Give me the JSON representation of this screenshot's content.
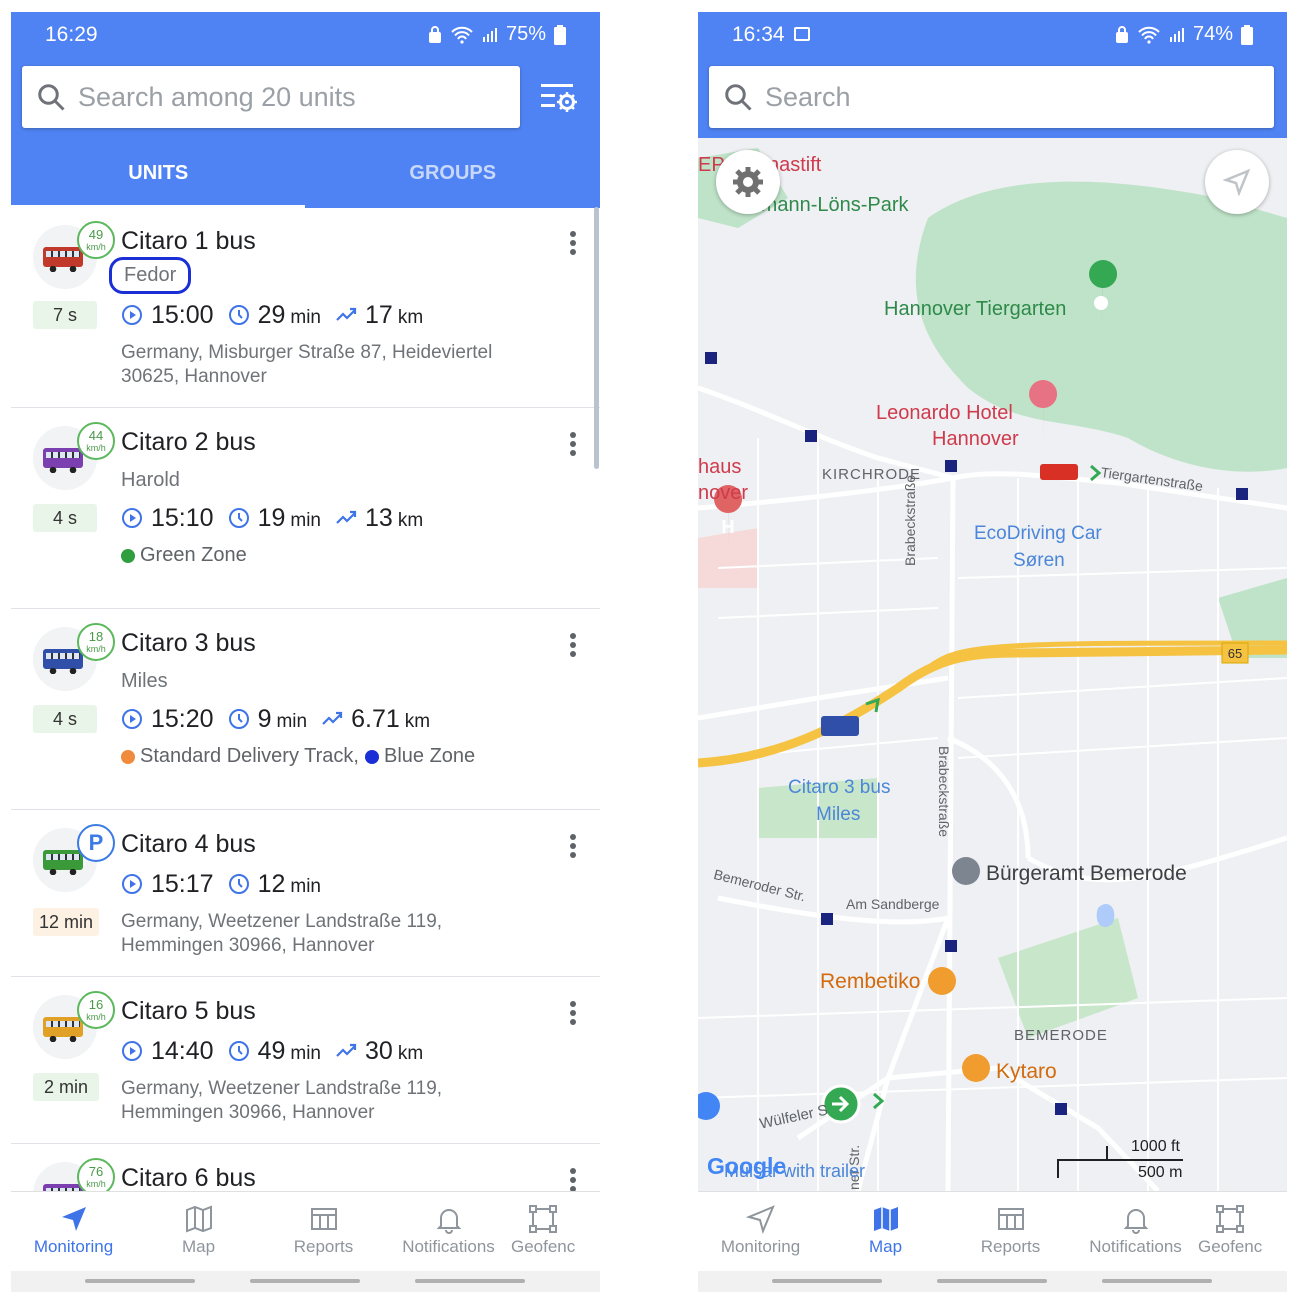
{
  "left": {
    "status": {
      "time": "16:29",
      "battery": "75%"
    },
    "search": {
      "placeholder": "Search among 20 units"
    },
    "tabs": [
      {
        "label": "UNITS"
      },
      {
        "label": "GROUPS"
      }
    ],
    "units": [
      {
        "name": "Citaro 1 bus",
        "driver": "Fedor",
        "speed": "49",
        "speed_unit": "km/h",
        "age": "7 s",
        "time": "15:00",
        "duration": "29",
        "duration_unit": "min",
        "distance": "17",
        "distance_unit": "km",
        "address_line1": "Germany, Misburger Straße 87, Heideviertel",
        "address_line2": "30625, Hannover",
        "bus_color": "#c0392b"
      },
      {
        "name": "Citaro 2 bus",
        "driver": "Harold",
        "speed": "44",
        "speed_unit": "km/h",
        "age": "4 s",
        "time": "15:10",
        "duration": "19",
        "duration_unit": "min",
        "distance": "13",
        "distance_unit": "km",
        "zone": "Green Zone",
        "zone_color": "#2e9e3e",
        "bus_color": "#7b3fb0"
      },
      {
        "name": "Citaro 3 bus",
        "driver": "Miles",
        "speed": "18",
        "speed_unit": "km/h",
        "age": "4 s",
        "time": "15:20",
        "duration": "9",
        "duration_unit": "min",
        "distance": "6.71",
        "distance_unit": "km",
        "zone_a": "Standard Delivery Track,",
        "zone_a_color": "#f08a3c",
        "zone_b": "Blue Zone",
        "zone_b_color": "#1a2fd6",
        "bus_color": "#2f4fa8"
      },
      {
        "name": "Citaro 4 bus",
        "parking": "P",
        "age": "12 min",
        "time": "15:17",
        "duration": "12",
        "duration_unit": "min",
        "address_line1": "Germany, Weetzener Landstraße 119,",
        "address_line2": "Hemmingen 30966, Hannover",
        "bus_color": "#3a9a3a"
      },
      {
        "name": "Citaro 5 bus",
        "speed": "16",
        "speed_unit": "km/h",
        "age": "2 min",
        "time": "14:40",
        "duration": "49",
        "duration_unit": "min",
        "distance": "30",
        "distance_unit": "km",
        "address_line1": "Germany, Weetzener Landstraße 119,",
        "address_line2": "Hemmingen 30966, Hannover",
        "bus_color": "#e0a126"
      },
      {
        "name": "Citaro 6 bus",
        "speed": "76",
        "speed_unit": "km/h",
        "bus_color": "#7b3fb0"
      }
    ],
    "nav": [
      {
        "label": "Monitoring"
      },
      {
        "label": "Map"
      },
      {
        "label": "Reports"
      },
      {
        "label": "Notifications"
      },
      {
        "label": "Geofenc"
      }
    ]
  },
  "right": {
    "status": {
      "time": "16:34",
      "battery": "74%"
    },
    "search": {
      "placeholder": "Search"
    },
    "map_labels": {
      "ep": "EP",
      "nastift": "nastift",
      "park": "rmann-Löns-Park",
      "tiergarten": "Hannover Tiergarten",
      "hotel_1": "Leonardo Hotel",
      "hotel_2": "Hannover",
      "haus": "haus",
      "nover": "nover",
      "kirchrode": "KIRCHRODE",
      "tiergartenstrasse": "Tiergartenstraße",
      "ecodriving_1": "EcoDriving Car",
      "ecodriving_2": "Søren",
      "brabeck_top": "Brabeckstraße",
      "brabeck_bottom": "Brabeckstraße",
      "route_65": "65",
      "citaro_1": "Citaro 3 bus",
      "citaro_2": "Miles",
      "buergeramt": "Bürgeramt Bemerode",
      "bemeroder": "Bemeroder Str.",
      "sandberge": "Am Sandberge",
      "rembetiko": "Rembetiko",
      "bemerode": "BEMERODE",
      "kytaro": "Kytaro",
      "wuelfeler": "Wülfeler S",
      "trailer": "Mulsar with trailer",
      "str_vertical": "ner Str.",
      "scale_ft": "1000 ft",
      "scale_m": "500 m",
      "google": "Google"
    },
    "nav": [
      {
        "label": "Monitoring"
      },
      {
        "label": "Map"
      },
      {
        "label": "Reports"
      },
      {
        "label": "Notifications"
      },
      {
        "label": "Geofenc"
      }
    ]
  },
  "colors": {
    "primary": "#4f82f2",
    "active_nav": "#3e74e8",
    "highlight": "#1a2fd6",
    "park_green": "#bfe3c8",
    "highway": "#f5c242"
  },
  "icons": [
    "search-icon",
    "filter-settings-icon",
    "play-circle-icon",
    "clock-icon",
    "trend-icon",
    "more-vert-icon",
    "navigation-arrow-icon",
    "map-icon",
    "reports-icon",
    "bell-icon",
    "geofence-icon",
    "gear-icon",
    "locate-icon"
  ]
}
